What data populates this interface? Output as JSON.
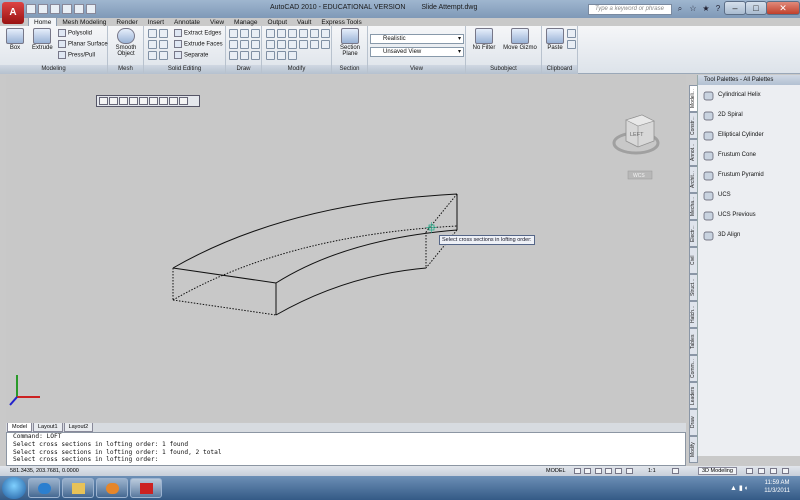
{
  "window": {
    "title_prefix": "AutoCAD 2010 - EDUCATIONAL VERSION",
    "document": "Slide Attempt.dwg",
    "search_placeholder": "Type a keyword or phrase"
  },
  "menu_tabs": [
    "Home",
    "Mesh Modeling",
    "Render",
    "Insert",
    "Annotate",
    "View",
    "Manage",
    "Output",
    "Vault",
    "Express Tools"
  ],
  "ribbon": {
    "modeling": {
      "title": "Modeling",
      "box": "Box",
      "extrude": "Extrude",
      "polysolid": "Polysolid",
      "planar_surface": "Planar Surface",
      "press_pull": "Press/Pull"
    },
    "mesh": {
      "title": "Mesh",
      "smooth_object": "Smooth Object"
    },
    "solid_editing": {
      "title": "Solid Editing",
      "extract_edges": "Extract Edges",
      "extrude_faces": "Extrude Faces",
      "separate": "Separate"
    },
    "draw": {
      "title": "Draw"
    },
    "modify": {
      "title": "Modify"
    },
    "section": {
      "title": "Section",
      "section_plane": "Section Plane"
    },
    "view": {
      "title": "View",
      "visual_style": "Realistic",
      "saved_view": "Unsaved View"
    },
    "subobject": {
      "title": "Subobject",
      "no_filter": "No Filter",
      "move_gizmo": "Move Gizmo"
    },
    "clipboard": {
      "title": "Clipboard",
      "paste": "Paste"
    }
  },
  "viewport": {
    "tooltip": "Select cross sections in lofting order:",
    "viewcube_face": "LEFT",
    "wcs_label": "WCS"
  },
  "palette": {
    "title": "Tool Palettes - All Palettes",
    "tabs": [
      "Modeli...",
      "Constr...",
      "Annot...",
      "Archit...",
      "Mecha...",
      "Electr...",
      "Civil",
      "Struct...",
      "Hatch...",
      "Tables",
      "Comm...",
      "Leaders",
      "Draw",
      "Modify"
    ],
    "items": [
      "Cylindrical Helix",
      "2D Spiral",
      "Elliptical Cylinder",
      "Frustum Cone",
      "Frustum Pyramid",
      "UCS",
      "UCS Previous",
      "3D Align"
    ]
  },
  "layout_tabs": [
    "Model",
    "Layout1",
    "Layout2"
  ],
  "command_lines": [
    "Command: LOFT",
    "Select cross sections in lofting order: 1 found",
    "Select cross sections in lofting order: 1 found, 2 total",
    "Select cross sections in lofting order:"
  ],
  "status": {
    "coordinates": "581.3435, 203.7681, 0.0000",
    "model_label": "MODEL",
    "scale": "1:1",
    "workspace": "3D Modeling"
  },
  "clock": {
    "time": "11:59 AM",
    "date": "11/3/2011"
  }
}
